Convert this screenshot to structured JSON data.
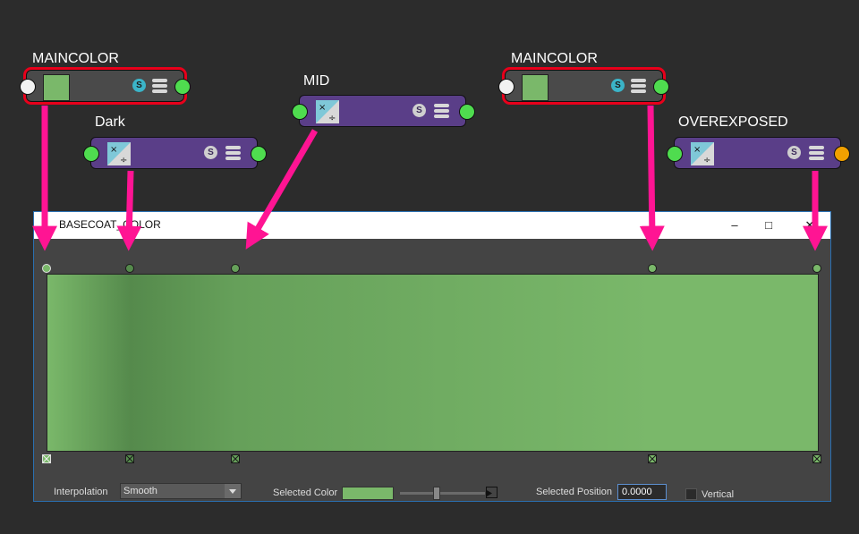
{
  "colors": {
    "main_green": "#7ab86a",
    "port_green": "#4fdc4f",
    "port_white": "#f2f2f2",
    "port_orange": "#f0a000",
    "arrow_pink": "#ff1493",
    "selected_red": "#e8001b",
    "node_purple": "#5a3e88",
    "s_cyan": "#3bb4c8",
    "s_gray": "#cfcfcf"
  },
  "nodes": [
    {
      "id": "maincolor-1",
      "title": "MAINCOLOR",
      "kind": "color",
      "selected": true,
      "input_port": "white",
      "output_port": "green",
      "s_badge": "S",
      "s_icon": "cyan-s-badge-icon",
      "menu_icon": "stack-menu-icon"
    },
    {
      "id": "dark",
      "title": "Dark",
      "kind": "math",
      "selected": false,
      "input_port": "green",
      "output_port": "green",
      "s_badge": "S",
      "s_icon": "gray-s-badge-icon",
      "menu_icon": "stack-menu-icon",
      "op_icon": "multiply-divide-icon"
    },
    {
      "id": "mid",
      "title": "MID",
      "kind": "math",
      "selected": false,
      "input_port": "green",
      "output_port": "green",
      "s_badge": "S",
      "s_icon": "gray-s-badge-icon",
      "menu_icon": "stack-menu-icon",
      "op_icon": "multiply-divide-icon"
    },
    {
      "id": "maincolor-2",
      "title": "MAINCOLOR",
      "kind": "color",
      "selected": true,
      "input_port": "white",
      "output_port": "green",
      "s_badge": "S",
      "s_icon": "cyan-s-badge-icon",
      "menu_icon": "stack-menu-icon"
    },
    {
      "id": "overexposed",
      "title": "OVEREXPOSED",
      "kind": "math",
      "selected": false,
      "input_port": "green",
      "output_port": "orange",
      "s_badge": "S",
      "s_icon": "gray-s-badge-icon",
      "menu_icon": "stack-menu-icon",
      "op_icon": "multiply-divide-icon"
    }
  ],
  "ramp_window": {
    "title": "BASECOAT_COLOR",
    "minimize_glyph": "–",
    "maximize_glyph": "□",
    "close_glyph": "✕"
  },
  "ramp": {
    "stops": [
      {
        "position": 0.0,
        "color": "#7ab86a",
        "selected": true
      },
      {
        "position": 0.108,
        "color": "#558a4c",
        "selected": false
      },
      {
        "position": 0.245,
        "color": "#66a05a",
        "selected": false
      },
      {
        "position": 0.786,
        "color": "#7ab86a",
        "selected": false
      },
      {
        "position": 1.0,
        "color": "#7ab86a",
        "selected": false
      }
    ],
    "interpolation_label": "Interpolation",
    "interpolation_value": "Smooth",
    "selected_color_label": "Selected Color",
    "selected_color": "#7ab86a",
    "selected_position_label": "Selected Position",
    "selected_position_value": "0.0000",
    "vertical_label": "Vertical",
    "vertical_checked": false
  }
}
